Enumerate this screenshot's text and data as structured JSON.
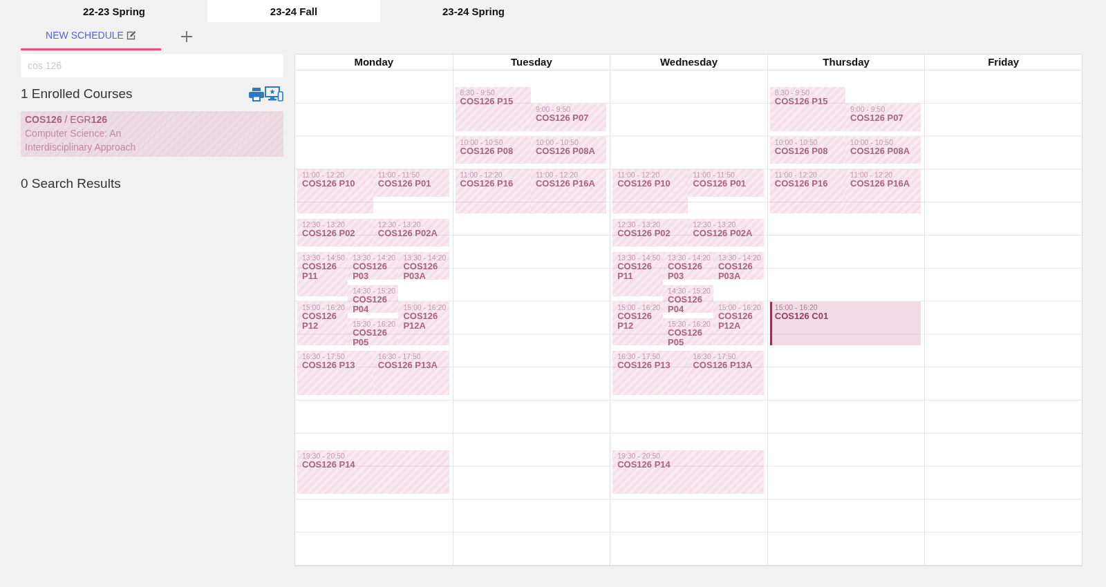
{
  "term_tabs": [
    {
      "label": "22-23 Spring",
      "selected": false
    },
    {
      "label": "23-24 Fall",
      "selected": true
    },
    {
      "label": "23-24 Spring",
      "selected": false
    }
  ],
  "schedule_tabs": [
    {
      "label": "NEW SCHEDULE",
      "selected": true
    }
  ],
  "search": {
    "placeholder": "cos 126"
  },
  "enrolled": {
    "heading": "1 Enrolled Courses",
    "courses": [
      {
        "code": "**COS126** / EGR**126**",
        "title": "Computer Science: An Interdisciplinary Approach"
      }
    ]
  },
  "search_results": {
    "heading": "0 Search Results"
  },
  "calendar": {
    "days": [
      {
        "name": "Monday",
        "groups": [
          {
            "lanes": [
              [
                {
                  "time": "11:00 - 12:20",
                  "title": "COS126 P10",
                  "selected": false
                }
              ],
              [
                {
                  "time": "11:00 - 11:50",
                  "title": "COS126 P01",
                  "selected": false
                }
              ]
            ]
          },
          {
            "lanes": [
              [
                {
                  "time": "12:30 - 13:20",
                  "title": "COS126 P02",
                  "selected": false
                }
              ],
              [
                {
                  "time": "12:30 - 13:20",
                  "title": "COS126 P02A",
                  "selected": false
                }
              ]
            ]
          },
          {
            "lanes": [
              [
                {
                  "time": "13:30 - 14:50",
                  "title": "COS126 P11",
                  "selected": false
                },
                {
                  "time": "15:00 - 16:20",
                  "title": "COS126 P12",
                  "selected": false
                }
              ],
              [
                {
                  "time": "13:30 - 14:20",
                  "title": "COS126 P03",
                  "selected": false
                },
                {
                  "time": "14:30 - 15:20",
                  "title": "COS126 P04",
                  "selected": false
                },
                {
                  "time": "15:30 - 16:20",
                  "title": "COS126 P05",
                  "selected": false
                }
              ],
              [
                {
                  "time": "13:30 - 14:20",
                  "title": "COS126 P03A",
                  "selected": false
                },
                {
                  "time": "15:00 - 16:20",
                  "title": "COS126 P12A",
                  "selected": false
                }
              ]
            ]
          },
          {
            "lanes": [
              [
                {
                  "time": "16:30 - 17:50",
                  "title": "COS126 P13",
                  "selected": false
                }
              ],
              [
                {
                  "time": "16:30 - 17:50",
                  "title": "COS126 P13A",
                  "selected": false
                }
              ]
            ]
          },
          {
            "lanes": [
              [
                {
                  "time": "19:30 - 20:50",
                  "title": "COS126 P14",
                  "selected": false
                }
              ]
            ]
          }
        ]
      },
      {
        "name": "Tuesday",
        "groups": [
          {
            "lanes": [
              [
                {
                  "time": "8:30 - 9:50",
                  "title": "COS126 P15",
                  "selected": false
                }
              ],
              [
                {
                  "time": "9:00 - 9:50",
                  "title": "COS126 P07",
                  "selected": false
                }
              ]
            ]
          },
          {
            "lanes": [
              [
                {
                  "time": "10:00 - 10:50",
                  "title": "COS126 P08",
                  "selected": false
                }
              ],
              [
                {
                  "time": "10:00 - 10:50",
                  "title": "COS126 P08A",
                  "selected": false
                }
              ]
            ]
          },
          {
            "lanes": [
              [
                {
                  "time": "11:00 - 12:20",
                  "title": "COS126 P16",
                  "selected": false
                }
              ],
              [
                {
                  "time": "11:00 - 12:20",
                  "title": "COS126 P16A",
                  "selected": false
                }
              ]
            ]
          }
        ]
      },
      {
        "name": "Wednesday",
        "groups": [
          {
            "lanes": [
              [
                {
                  "time": "11:00 - 12:20",
                  "title": "COS126 P10",
                  "selected": false
                }
              ],
              [
                {
                  "time": "11:00 - 11:50",
                  "title": "COS126 P01",
                  "selected": false
                }
              ]
            ]
          },
          {
            "lanes": [
              [
                {
                  "time": "12:30 - 13:20",
                  "title": "COS126 P02",
                  "selected": false
                }
              ],
              [
                {
                  "time": "12:30 - 13:20",
                  "title": "COS126 P02A",
                  "selected": false
                }
              ]
            ]
          },
          {
            "lanes": [
              [
                {
                  "time": "13:30 - 14:50",
                  "title": "COS126 P11",
                  "selected": false
                },
                {
                  "time": "15:00 - 16:20",
                  "title": "COS126 P12",
                  "selected": false
                }
              ],
              [
                {
                  "time": "13:30 - 14:20",
                  "title": "COS126 P03",
                  "selected": false
                },
                {
                  "time": "14:30 - 15:20",
                  "title": "COS126 P04",
                  "selected": false
                },
                {
                  "time": "15:30 - 16:20",
                  "title": "COS126 P05",
                  "selected": false
                }
              ],
              [
                {
                  "time": "13:30 - 14:20",
                  "title": "COS126 P03A",
                  "selected": false
                },
                {
                  "time": "15:00 - 16:20",
                  "title": "COS126 P12A",
                  "selected": false
                }
              ]
            ]
          },
          {
            "lanes": [
              [
                {
                  "time": "16:30 - 17:50",
                  "title": "COS126 P13",
                  "selected": false
                }
              ],
              [
                {
                  "time": "16:30 - 17:50",
                  "title": "COS126 P13A",
                  "selected": false
                }
              ]
            ]
          },
          {
            "lanes": [
              [
                {
                  "time": "19:30 - 20:50",
                  "title": "COS126 P14",
                  "selected": false
                }
              ]
            ]
          }
        ]
      },
      {
        "name": "Thursday",
        "groups": [
          {
            "lanes": [
              [
                {
                  "time": "8:30 - 9:50",
                  "title": "COS126 P15",
                  "selected": false
                }
              ],
              [
                {
                  "time": "9:00 - 9:50",
                  "title": "COS126 P07",
                  "selected": false
                }
              ]
            ]
          },
          {
            "lanes": [
              [
                {
                  "time": "10:00 - 10:50",
                  "title": "COS126 P08",
                  "selected": false
                }
              ],
              [
                {
                  "time": "10:00 - 10:50",
                  "title": "COS126 P08A",
                  "selected": false
                }
              ]
            ]
          },
          {
            "lanes": [
              [
                {
                  "time": "11:00 - 12:20",
                  "title": "COS126 P16",
                  "selected": false
                }
              ],
              [
                {
                  "time": "11:00 - 12:20",
                  "title": "COS126 P16A",
                  "selected": false
                }
              ]
            ]
          },
          {
            "lanes": [
              [
                {
                  "time": "15:00 - 16:20",
                  "title": "COS126 C01",
                  "selected": true
                }
              ]
            ]
          }
        ]
      },
      {
        "name": "Friday"
      }
    ]
  }
}
